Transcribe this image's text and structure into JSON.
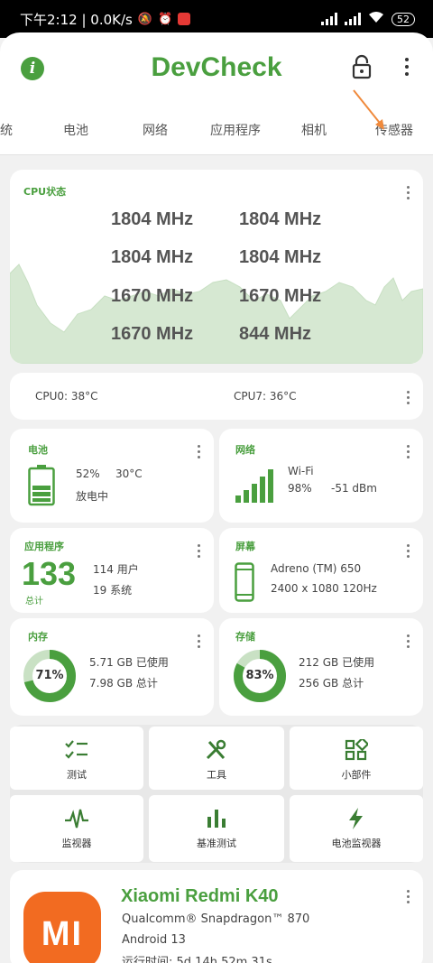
{
  "status_bar": {
    "time_net": "下午2:12 | 0.0K/s",
    "battery": "52"
  },
  "app": {
    "title": "DevCheck"
  },
  "tabs": [
    "统",
    "电池",
    "网络",
    "应用程序",
    "相机",
    "传感器"
  ],
  "cpu": {
    "title": "CPU状态",
    "freqs": [
      "1804 MHz",
      "1804 MHz",
      "1804 MHz",
      "1804 MHz",
      "1670 MHz",
      "1670 MHz",
      "1670 MHz",
      "844 MHz"
    ],
    "temp0": "CPU0: 38°C",
    "temp7": "CPU7: 36°C"
  },
  "battery": {
    "title": "电池",
    "percent": "52%",
    "temp": "30°C",
    "status": "放电中",
    "level": 0.52
  },
  "network": {
    "title": "网络",
    "type": "Wi-Fi",
    "strength": "98%",
    "dbm": "-51 dBm"
  },
  "apps": {
    "title": "应用程序",
    "total": "133",
    "total_label": "总计",
    "user": "114 用户",
    "system": "19 系统"
  },
  "display": {
    "title": "屏幕",
    "gpu": "Adreno (TM) 650",
    "res": "2400 x 1080  120Hz"
  },
  "memory": {
    "title": "内存",
    "percent": "71%",
    "used": "5.71 GB 已使用",
    "total": "7.98 GB 总计",
    "fraction": 0.71
  },
  "storage": {
    "title": "存储",
    "percent": "83%",
    "used": "212 GB 已使用",
    "total": "256 GB 总计",
    "fraction": 0.83
  },
  "tools": [
    "测试",
    "工具",
    "小部件",
    "监视器",
    "基准测试",
    "电池监视器"
  ],
  "device": {
    "name": "Xiaomi Redmi K40",
    "soc": "Qualcomm® Snapdragon™ 870",
    "os": "Android 13",
    "uptime": "运行时间: 5d 14h 52m 31s",
    "logo_text": "MI"
  },
  "colors": {
    "accent": "#4a9f3f",
    "logo": "#f26b21"
  }
}
